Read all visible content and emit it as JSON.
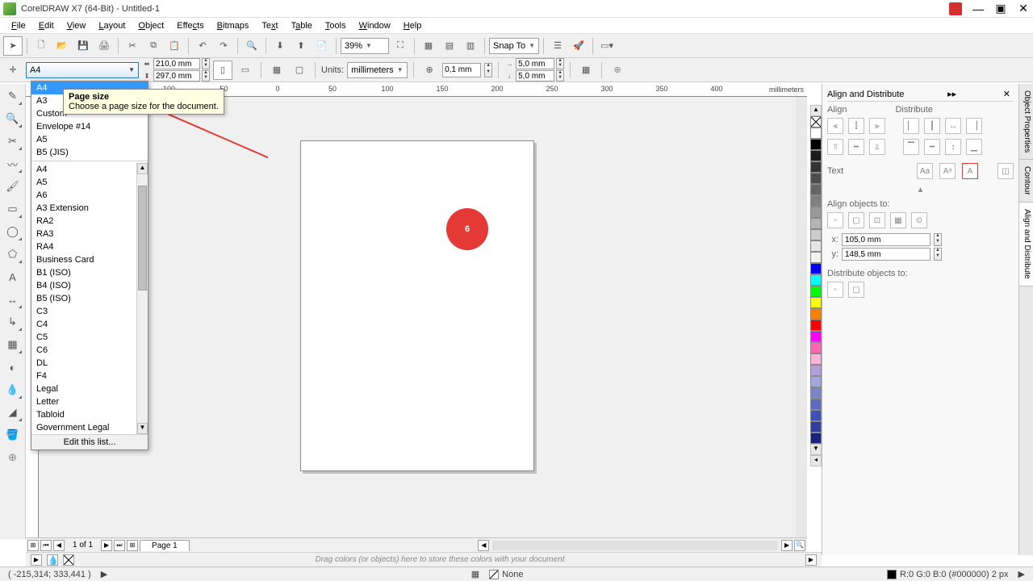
{
  "titlebar": {
    "title": "CorelDRAW X7 (64-Bit) - Untitled-1"
  },
  "menubar": [
    "File",
    "Edit",
    "View",
    "Layout",
    "Object",
    "Effects",
    "Bitmaps",
    "Text",
    "Table",
    "Tools",
    "Window",
    "Help"
  ],
  "toolbar1": {
    "zoom": "39%",
    "snap_label": "Snap To"
  },
  "propbar": {
    "page_size": "A4",
    "width": "210,0 mm",
    "height": "297,0 mm",
    "units_label": "Units:",
    "units_value": "millimeters",
    "nudge": "0,1 mm",
    "dupe_x": "5,0 mm",
    "dupe_y": "5,0 mm"
  },
  "tooltip": {
    "title": "Page size",
    "body": "Choose a page size for the document."
  },
  "dropdown": {
    "top": [
      "A4",
      "A3",
      "Custom",
      "Envelope #14",
      "A5",
      "B5 (JIS)"
    ],
    "list": [
      "A4",
      "A5",
      "A6",
      "A3 Extension",
      "RA2",
      "RA3",
      "RA4",
      "Business Card",
      "B1 (ISO)",
      "B4 (ISO)",
      "B5 (ISO)",
      "C3",
      "C4",
      "C5",
      "C6",
      "DL",
      "F4",
      "Legal",
      "Letter",
      "Tabloid",
      "Government Legal"
    ],
    "edit": "Edit this list..."
  },
  "ruler": {
    "unit": "millimeters",
    "ticks": [
      "-100",
      "-50",
      "0",
      "50",
      "100",
      "150",
      "200",
      "250",
      "300",
      "350",
      "400"
    ]
  },
  "circle": "6",
  "page_tabs": {
    "info": "1 of 1",
    "tab": "Page 1"
  },
  "right_panel": {
    "title": "Align and Distribute",
    "align": "Align",
    "distribute": "Distribute",
    "text": "Text",
    "align_obj": "Align objects to:",
    "x": "105,0 mm",
    "y": "148,5 mm",
    "distribute_obj": "Distribute objects to:",
    "tabs": [
      "Object Properties",
      "Contour",
      "Align and Distribute"
    ]
  },
  "doc_tray": {
    "hint": "Drag colors (or objects) here to store these colors with your document"
  },
  "statusbar": {
    "coords": "( -215,314;  333,441 )",
    "fill": "None",
    "outline": "R:0 G:0 B:0 (#000000)  2 px"
  },
  "colors": [
    "#ffffff",
    "#000000",
    "#1a1a1a",
    "#333333",
    "#4d4d4d",
    "#666666",
    "#808080",
    "#999999",
    "#b3b3b3",
    "#cccccc",
    "#e6e6e6",
    "#f2f2f2",
    "#0000ff",
    "#00ffff",
    "#00ff00",
    "#ffff00",
    "#ff8000",
    "#ff0000",
    "#ff00ff",
    "#ff66b3",
    "#ffb3d9",
    "#b39ddb",
    "#9fa8da",
    "#7986cb",
    "#5c6bc0",
    "#3f51b5",
    "#303f9f",
    "#1a237e"
  ]
}
